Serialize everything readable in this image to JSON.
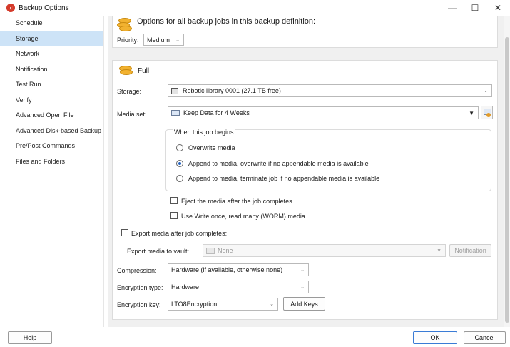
{
  "window": {
    "title": "Backup Options",
    "minimize_glyph": "—",
    "maximize_glyph": "☐",
    "close_glyph": "✕"
  },
  "sidebar": {
    "items": [
      {
        "label": "Schedule"
      },
      {
        "label": "Storage"
      },
      {
        "label": "Network"
      },
      {
        "label": "Notification"
      },
      {
        "label": "Test Run"
      },
      {
        "label": "Verify"
      },
      {
        "label": "Advanced Open File"
      },
      {
        "label": "Advanced Disk-based Backup"
      },
      {
        "label": "Pre/Post Commands"
      },
      {
        "label": "Files and Folders"
      }
    ],
    "selected": "Storage"
  },
  "options_header": {
    "text": "Options for all backup jobs in this backup definition:",
    "priority_label": "Priority:",
    "priority_value": "Medium"
  },
  "full": {
    "title": "Full",
    "storage_label": "Storage:",
    "storage_value": "Robotic library 0001 (27.1 TB free)",
    "media_set_label": "Media set:",
    "media_set_value": "Keep Data for 4 Weeks",
    "job_begins_title": "When this job begins",
    "radio_options": [
      {
        "label": "Overwrite media",
        "selected": false
      },
      {
        "label": "Append to media, overwrite if no appendable media is available",
        "selected": true
      },
      {
        "label": "Append to media, terminate job if no appendable media is available",
        "selected": false
      }
    ],
    "eject_label": "Eject the media after the job completes",
    "eject_checked": false,
    "worm_label": "Use Write once, read many (WORM) media",
    "worm_checked": false,
    "export_label": "Export media after job completes:",
    "export_checked": false,
    "export_vault_label": "Export media to vault:",
    "export_vault_value": "None",
    "notification_button": "Notification",
    "compression_label": "Compression:",
    "compression_value": "Hardware (if available, otherwise none)",
    "encryption_type_label": "Encryption type:",
    "encryption_type_value": "Hardware",
    "encryption_key_label": "Encryption key:",
    "encryption_key_value": "LTO8Encryption",
    "add_keys_button": "Add Keys"
  },
  "footer": {
    "help": "Help",
    "ok": "OK",
    "cancel": "Cancel"
  },
  "colors": {
    "accent": "#3a7bd5",
    "sidebar_selected": "#cde3f7",
    "content_bg": "#f0f0f0",
    "app_icon": "#d43a2a"
  }
}
